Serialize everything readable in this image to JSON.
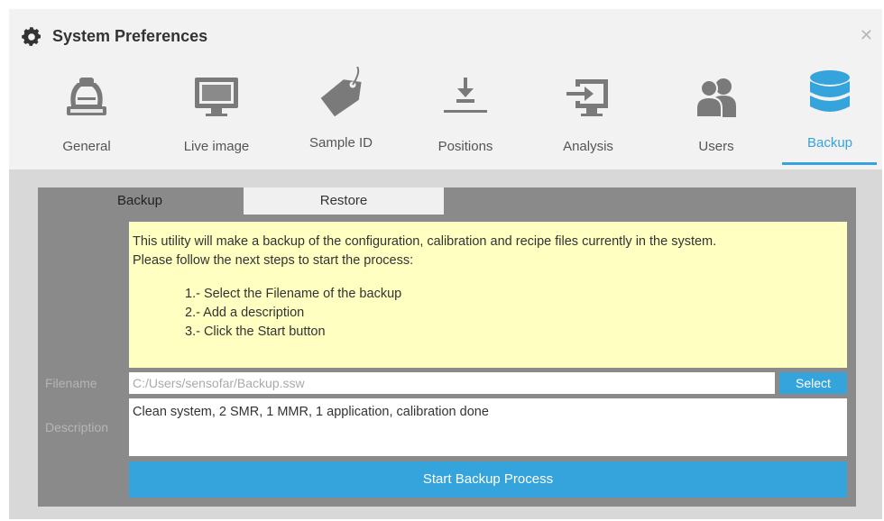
{
  "window": {
    "title": "System Preferences",
    "close_icon": "close-icon"
  },
  "tabs": [
    {
      "label": "General",
      "icon": "microscope-icon"
    },
    {
      "label": "Live image",
      "icon": "monitor-icon"
    },
    {
      "label": "Sample ID",
      "icon": "tag-icon"
    },
    {
      "label": "Positions",
      "icon": "positions-icon"
    },
    {
      "label": "Analysis",
      "icon": "analysis-icon"
    },
    {
      "label": "Users",
      "icon": "users-icon"
    },
    {
      "label": "Backup",
      "icon": "database-icon",
      "active": true
    }
  ],
  "subtabs": {
    "backup_label": "Backup",
    "restore_label": "Restore"
  },
  "info": {
    "line1": "This utility will make a backup of the configuration, calibration and recipe files currently in the system.",
    "line2": "Please follow the next steps to start the process:",
    "step1": "1.- Select the Filename of the backup",
    "step2": "2.- Add a description",
    "step3": "3.- Click the Start button"
  },
  "form": {
    "filename_label": "Filename",
    "filename_value": "C:/Users/sensofar/Backup.ssw",
    "select_label": "Select",
    "description_label": "Description",
    "description_value": "Clean system, 2 SMR, 1 MMR, 1 application, calibration done",
    "start_label": "Start Backup Process"
  },
  "colors": {
    "accent": "#35a3dc",
    "info_bg": "#ffffc2",
    "panel_bg": "#8a8a8a"
  }
}
